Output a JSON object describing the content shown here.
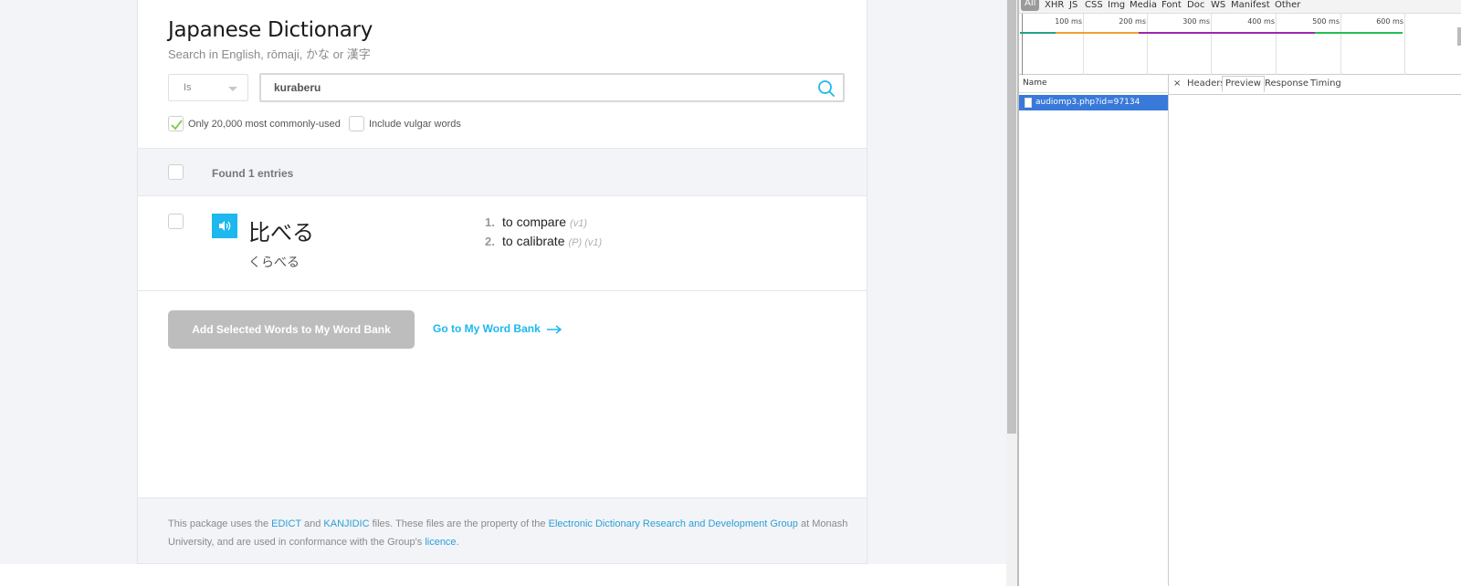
{
  "dictionary": {
    "title": "Japanese Dictionary",
    "subtitle": "Search in English, rōmaji, かな or 漢字",
    "match_select": {
      "selected": "Is"
    },
    "search": {
      "value": "kuraberu",
      "placeholder": ""
    },
    "options": [
      {
        "label": "Only 20,000 most commonly-used",
        "checked": true
      },
      {
        "label": "Include vulgar words",
        "checked": false
      }
    ],
    "results_header": "Found 1 entries",
    "entries": [
      {
        "kanji": "比べる",
        "kana": "くらべる",
        "meanings": [
          {
            "num": "1.",
            "text": "to compare",
            "tags": "(v1)"
          },
          {
            "num": "2.",
            "text": "to calibrate",
            "tags": "(P) (v1)"
          }
        ]
      }
    ],
    "add_button": "Add Selected Words to My Word Bank",
    "go_link": "Go to My Word Bank",
    "footer": {
      "t1": "This package uses the ",
      "edict": "EDICT",
      "t2": " and ",
      "kanjidic": "KANJIDIC",
      "t3": " files. These files are the property of the ",
      "edrdg": "Electronic Dictionary Research and Development Group",
      "t4": " at Monash University, and are used in conformance with the Group's ",
      "licence": "licence",
      "t5": "."
    },
    "accent_color": "#1cb8ee",
    "checkmark_color": "#7ac943"
  },
  "devtools": {
    "filters": [
      "All",
      "XHR",
      "JS",
      "CSS",
      "Img",
      "Media",
      "Font",
      "Doc",
      "WS",
      "Manifest",
      "Other"
    ],
    "timeline_ticks": [
      "100 ms",
      "200 ms",
      "300 ms",
      "400 ms",
      "500 ms",
      "600 ms"
    ],
    "name_header": "Name",
    "requests": [
      {
        "name": "audiomp3.php?id=97134",
        "selected": true
      }
    ],
    "detail_tabs": [
      "×",
      "Headers",
      "Preview",
      "Response",
      "Timing"
    ],
    "active_detail_tab": "Preview",
    "selection_color": "#3879d9"
  }
}
